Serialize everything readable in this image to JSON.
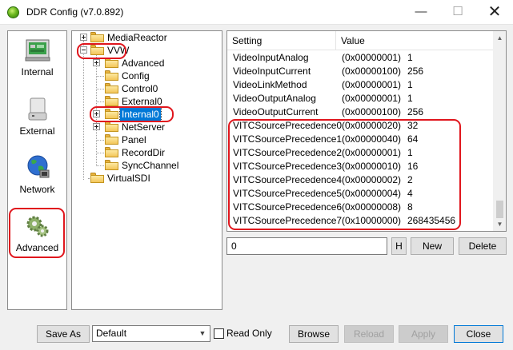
{
  "window": {
    "title": "DDR Config (v7.0.892)",
    "minimize": "—",
    "maximize": "☐",
    "close": "✕"
  },
  "sidebar": {
    "items": [
      {
        "label": "Internal",
        "icon": "internal-icon"
      },
      {
        "label": "External",
        "icon": "external-drive-icon"
      },
      {
        "label": "Network",
        "icon": "network-globe-icon"
      },
      {
        "label": "Advanced",
        "icon": "gears-icon"
      }
    ]
  },
  "tree": {
    "items": [
      {
        "label": "MediaReactor",
        "expander": "plus"
      },
      {
        "label": "VVW",
        "expander": "minus"
      },
      {
        "label": "Advanced",
        "expander": "plus"
      },
      {
        "label": "Config"
      },
      {
        "label": "Control0"
      },
      {
        "label": "External0"
      },
      {
        "label": "Internal0",
        "expander": "plus",
        "selected": true
      },
      {
        "label": "NetServer",
        "expander": "plus"
      },
      {
        "label": "Panel"
      },
      {
        "label": "RecordDir"
      },
      {
        "label": "SyncChannel"
      },
      {
        "label": "VirtualSDI"
      }
    ]
  },
  "settings": {
    "columns": {
      "setting": "Setting",
      "value": "Value"
    },
    "rows": [
      {
        "name": "VideoInputAnalog",
        "hex": "(0x00000001)",
        "dec": "1"
      },
      {
        "name": "VideoInputCurrent",
        "hex": "(0x00000100)",
        "dec": "256"
      },
      {
        "name": "VideoLinkMethod",
        "hex": "(0x00000001)",
        "dec": "1"
      },
      {
        "name": "VideoOutputAnalog",
        "hex": "(0x00000001)",
        "dec": "1"
      },
      {
        "name": "VideoOutputCurrent",
        "hex": "(0x00000100)",
        "dec": "256"
      },
      {
        "name": "VITCSourcePrecedence0",
        "hex": "(0x00000020)",
        "dec": "32"
      },
      {
        "name": "VITCSourcePrecedence1",
        "hex": "(0x00000040)",
        "dec": "64"
      },
      {
        "name": "VITCSourcePrecedence2",
        "hex": "(0x00000001)",
        "dec": "1"
      },
      {
        "name": "VITCSourcePrecedence3",
        "hex": "(0x00000010)",
        "dec": "16"
      },
      {
        "name": "VITCSourcePrecedence4",
        "hex": "(0x00000002)",
        "dec": "2"
      },
      {
        "name": "VITCSourcePrecedence5",
        "hex": "(0x00000004)",
        "dec": "4"
      },
      {
        "name": "VITCSourcePrecedence6",
        "hex": "(0x00000008)",
        "dec": "8"
      },
      {
        "name": "VITCSourcePrecedence7",
        "hex": "(0x10000000)",
        "dec": "268435456"
      }
    ]
  },
  "editor": {
    "value": "0",
    "hex_button": "H",
    "new_button": "New",
    "delete_button": "Delete"
  },
  "footer": {
    "save_as": "Save As",
    "profile_selected": "Default",
    "read_only_label": "Read Only",
    "read_only_checked": false,
    "browse": "Browse",
    "reload": "Reload",
    "apply": "Apply",
    "close": "Close"
  },
  "colors": {
    "annotation_red": "#e0161d",
    "selection_blue": "#0078d7",
    "disabled_text": "#a0a0a0"
  }
}
